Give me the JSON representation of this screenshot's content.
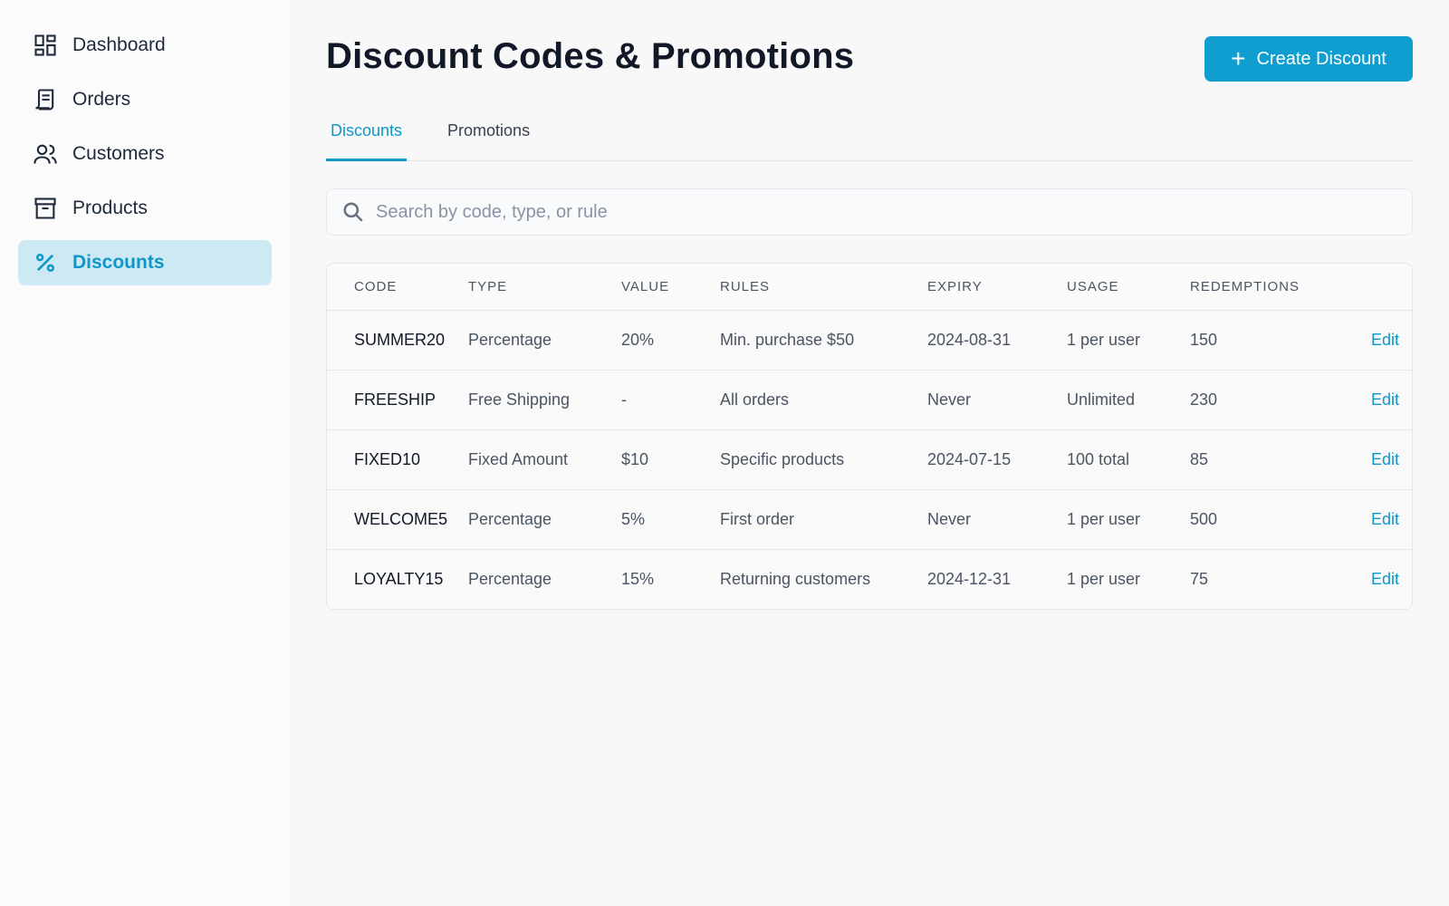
{
  "sidebar": {
    "items": [
      {
        "label": "Dashboard",
        "icon": "dashboard-icon",
        "active": false
      },
      {
        "label": "Orders",
        "icon": "receipt-icon",
        "active": false
      },
      {
        "label": "Customers",
        "icon": "users-icon",
        "active": false
      },
      {
        "label": "Products",
        "icon": "archive-box-icon",
        "active": false
      },
      {
        "label": "Discounts",
        "icon": "percent-icon",
        "active": true
      }
    ]
  },
  "header": {
    "title": "Discount Codes & Promotions",
    "create_button_label": "Create Discount"
  },
  "tabs": [
    {
      "label": "Discounts",
      "active": true
    },
    {
      "label": "Promotions",
      "active": false
    }
  ],
  "search": {
    "placeholder": "Search by code, type, or rule",
    "value": ""
  },
  "table": {
    "columns": [
      "CODE",
      "TYPE",
      "VALUE",
      "RULES",
      "EXPIRY",
      "USAGE",
      "REDEMPTIONS"
    ],
    "rows": [
      {
        "code": "SUMMER20",
        "type": "Percentage",
        "value": "20%",
        "rules": "Min. purchase $50",
        "expiry": "2024-08-31",
        "usage": "1 per user",
        "redemptions": "150",
        "action": "Edit"
      },
      {
        "code": "FREESHIP",
        "type": "Free Shipping",
        "value": "-",
        "rules": "All orders",
        "expiry": "Never",
        "usage": "Unlimited",
        "redemptions": "230",
        "action": "Edit"
      },
      {
        "code": "FIXED10",
        "type": "Fixed Amount",
        "value": "$10",
        "rules": "Specific products",
        "expiry": "2024-07-15",
        "usage": "100 total",
        "redemptions": "85",
        "action": "Edit"
      },
      {
        "code": "WELCOME5",
        "type": "Percentage",
        "value": "5%",
        "rules": "First order",
        "expiry": "Never",
        "usage": "1 per user",
        "redemptions": "500",
        "action": "Edit"
      },
      {
        "code": "LOYALTY15",
        "type": "Percentage",
        "value": "15%",
        "rules": "Returning customers",
        "expiry": "2024-12-31",
        "usage": "1 per user",
        "redemptions": "75",
        "action": "Edit"
      }
    ]
  },
  "colors": {
    "accent": "#109ed0",
    "active_nav_bg": "#cde9f4",
    "title_text": "#111827"
  }
}
